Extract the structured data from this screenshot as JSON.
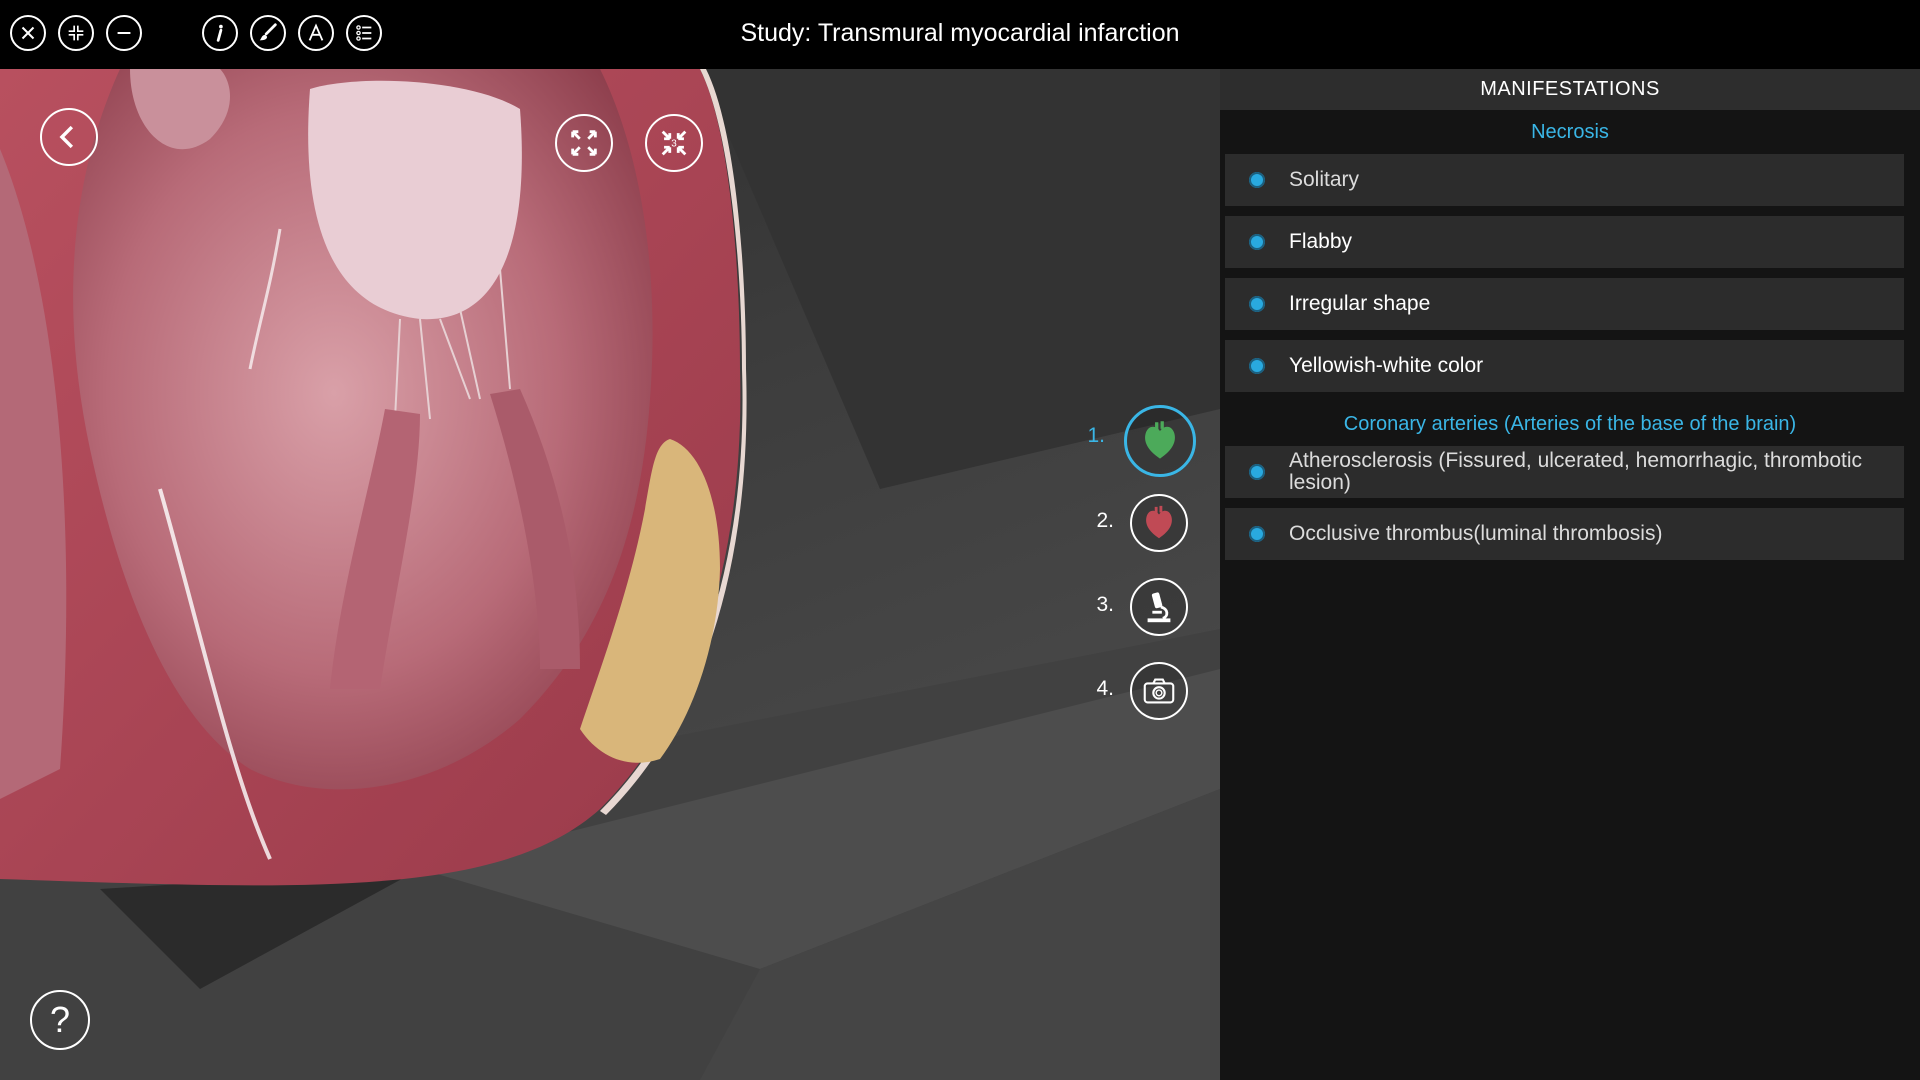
{
  "title": "Study: Transmural myocardial infarction",
  "toolbar": {
    "left_icons": [
      "close-icon",
      "collapse-icon",
      "minimize-icon"
    ],
    "tool_icons": [
      "info-icon",
      "brush-icon",
      "text-label-icon",
      "list-icon"
    ]
  },
  "viewer": {
    "step3_badge": "3",
    "steps": [
      {
        "number": "1.",
        "icon": "heart-icon",
        "active": true
      },
      {
        "number": "2.",
        "icon": "heart-icon",
        "active": false
      },
      {
        "number": "3.",
        "icon": "microscope-icon",
        "active": false
      },
      {
        "number": "4.",
        "icon": "camera-icon",
        "active": false
      }
    ],
    "help_label": "?"
  },
  "panel": {
    "header": "MANIFESTATIONS",
    "sections": [
      {
        "title": "Necrosis",
        "items": [
          "Solitary",
          "Flabby",
          "Irregular shape",
          "Yellowish-white color"
        ]
      },
      {
        "title": "Coronary arteries (Arteries of the base of the brain)",
        "items": [
          "Atherosclerosis (Fissured, ulcerated, hemorrhagic, thrombotic lesion)",
          "Occlusive thrombus(luminal thrombosis)"
        ]
      }
    ]
  },
  "colors": {
    "accent": "#3ab6e6",
    "bullet": "#29a9df",
    "panel_bg": "#141414",
    "item_bg": "#2c2c2c",
    "topbar_bg": "#000000"
  }
}
